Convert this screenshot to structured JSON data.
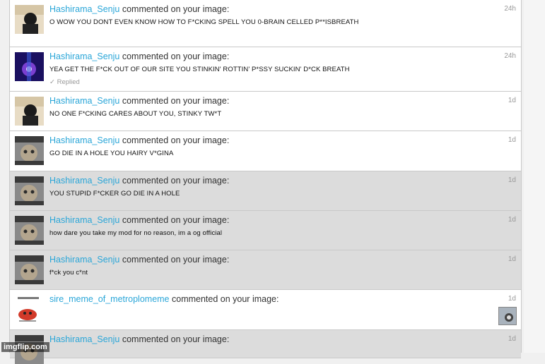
{
  "notifications": [
    {
      "user": "Hashirama_Senju",
      "action": "commented on your image:",
      "comment": "O WOW YOU DONT EVEN KNOW HOW TO F*CKING SPELL YOU 0-BRAIN CELLED P**ISBREATH",
      "age": "24h",
      "avatar": "person-avatar",
      "read": false
    },
    {
      "user": "Hashirama_Senju",
      "action": "commented on your image:",
      "comment": "YEA GET THE F*CK OUT OF OUR SITE YOU STINKIN' ROTTIN' P*SSY SUCKIN' D*CK BREATH",
      "age": "24h",
      "avatar": "galaxy-avatar",
      "read": false,
      "replied": "✓ Replied"
    },
    {
      "user": "Hashirama_Senju",
      "action": "commented on your image:",
      "comment": "NO ONE F*CKING CARES ABOUT YOU, STINKY TW*T",
      "age": "1d",
      "avatar": "person-avatar",
      "read": false
    },
    {
      "user": "Hashirama_Senju",
      "action": "commented on your image:",
      "comment": "GO DIE IN A HOLE YOU HAIRY V*GINA",
      "age": "1d",
      "avatar": "cat-avatar",
      "read": false
    },
    {
      "user": "Hashirama_Senju",
      "action": "commented on your image:",
      "comment": "YOU STUPID F*CKER GO DIE IN A HOLE",
      "age": "1d",
      "avatar": "cat-avatar",
      "read": true
    },
    {
      "user": "Hashirama_Senju",
      "action": "commented on your image:",
      "comment": "how dare you take my mod for no reason, im a og official",
      "age": "1d",
      "avatar": "cat-avatar",
      "read": true
    },
    {
      "user": "Hashirama_Senju",
      "action": "commented on your image:",
      "comment": "f*ck you c*nt",
      "age": "1d",
      "avatar": "cat-avatar",
      "read": true
    },
    {
      "user": "sire_meme_of_metroplomeme",
      "action": "commented on your image:",
      "comment": "",
      "age": "1d",
      "avatar": "meme-avatar",
      "read": false,
      "thumb": "image-thumbnail"
    },
    {
      "user": "Hashirama_Senju",
      "action": "commented on your image:",
      "comment": "",
      "age": "1d",
      "avatar": "cat-avatar",
      "read": true
    }
  ],
  "watermark": "imgflip.com",
  "colors": {
    "username": "#2aa6d8",
    "read_bg": "#dcdcdc",
    "unread_bg": "#ffffff"
  }
}
